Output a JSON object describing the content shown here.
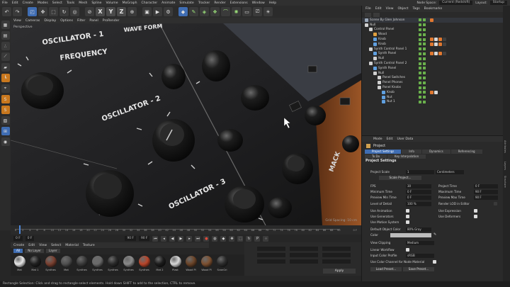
{
  "menu": {
    "items": [
      "File",
      "Edit",
      "Create",
      "Modes",
      "Select",
      "Tools",
      "Mesh",
      "Spline",
      "Volume",
      "MoGraph",
      "Character",
      "Animate",
      "Simulate",
      "Tracker",
      "Render",
      "Extensions",
      "Window",
      "Help"
    ],
    "node_space_label": "Node Space:",
    "node_space_value": "Current (Redshift)",
    "layout_label": "Layout:",
    "layout_value": "Startup"
  },
  "toolbar": {
    "axes": [
      "X",
      "Y",
      "Z"
    ]
  },
  "viewport": {
    "menu": [
      "View",
      "Cameras",
      "Display",
      "Options",
      "Filter",
      "Panel",
      "ProRender"
    ],
    "camera_label": "Perspective",
    "grid_info": "Grid Spacing: 10 cm",
    "panel_text": {
      "osc1": "OSCILLATOR - 1",
      "freq": "FREQUENCY",
      "wave": "WAVE FORM",
      "osc2": "OSCILLATOR - 2",
      "osc3": "OSCILLATOR - 3",
      "brand": "MACK"
    }
  },
  "timeline": {
    "ticks": [
      "0",
      "2",
      "4",
      "6",
      "8",
      "10",
      "12",
      "14",
      "16",
      "18",
      "20",
      "22",
      "24",
      "26",
      "28",
      "30",
      "32",
      "34",
      "36",
      "38",
      "40",
      "42",
      "44",
      "46",
      "48",
      "50",
      "52",
      "54",
      "56",
      "58",
      "60",
      "62",
      "64",
      "66",
      "68",
      "70",
      "72",
      "74",
      "76",
      "78",
      "80",
      "82",
      "84",
      "86",
      "88",
      "90"
    ],
    "end_label": "0 F"
  },
  "playback": {
    "start": "0 F",
    "current": "0 F",
    "end": "90 F",
    "end2": "90 F"
  },
  "materials": {
    "menu": [
      "Create",
      "Edit",
      "View",
      "Select",
      "Material",
      "Texture"
    ],
    "filters": [
      "All",
      "No Layer",
      "Layer"
    ],
    "items": [
      {
        "label": "Mat",
        "color": "#e8e8e8"
      },
      {
        "label": "Mat 1",
        "color": "#202020"
      },
      {
        "label": "Synthes",
        "color": "#7a4030"
      },
      {
        "label": "Mat",
        "color": "#505050"
      },
      {
        "label": "Synthes",
        "color": "#3a3a3a"
      },
      {
        "label": "Synthes",
        "color": "#6a6a6a"
      },
      {
        "label": "Synthes",
        "color": "#2a2a2a"
      },
      {
        "label": "Synthes",
        "color": "#8a8a8a"
      },
      {
        "label": "Synthes",
        "color": "#b8452a"
      },
      {
        "label": "Mat 2",
        "color": "#1c1c1c"
      },
      {
        "label": "Plast",
        "color": "#d8d8d8"
      },
      {
        "label": "Wood Pl",
        "color": "#6b4428"
      },
      {
        "label": "Wood Pl",
        "color": "#7d5030"
      },
      {
        "label": "ScanGri",
        "color": "#2c2c2c"
      }
    ]
  },
  "coords": {
    "apply_label": "Apply"
  },
  "status": {
    "text": "Rectangle Selection: Click and drag to rectangle-select elements. Hold down SHIFT to add to the selection, CTRL to remove."
  },
  "objects": {
    "menu": [
      "File",
      "Edit",
      "View",
      "Object",
      "Tags",
      "Bookmarks"
    ],
    "rows": [
      {
        "label": "Scene By Glen Johnson",
        "indent": 0,
        "color": "#9aa7b8"
      },
      {
        "label": "Null",
        "indent": 0,
        "color": "#d0d0d0"
      },
      {
        "label": "Control Panel",
        "indent": 1,
        "color": "#d0d0d0"
      },
      {
        "label": "Wood",
        "indent": 2,
        "color": "#e0a040"
      },
      {
        "label": "Knob",
        "indent": 2,
        "color": "#60a0e0"
      },
      {
        "label": "Knob",
        "indent": 2,
        "color": "#60a0e0"
      },
      {
        "label": "Synth Control Panel 1",
        "indent": 1,
        "color": "#d0d0d0"
      },
      {
        "label": "Synth Panel",
        "indent": 2,
        "color": "#60a0e0"
      },
      {
        "label": "Null",
        "indent": 2,
        "color": "#d0d0d0"
      },
      {
        "label": "Synth Control Panel 2",
        "indent": 1,
        "color": "#d0d0d0"
      },
      {
        "label": "Synth Panel",
        "indent": 2,
        "color": "#60a0e0"
      },
      {
        "label": "Null",
        "indent": 2,
        "color": "#d0d0d0"
      },
      {
        "label": "Panel Switches",
        "indent": 3,
        "color": "#d0d0d0"
      },
      {
        "label": "Panel Phones",
        "indent": 3,
        "color": "#d0d0d0"
      },
      {
        "label": "Panel Knobs",
        "indent": 3,
        "color": "#d0d0d0"
      },
      {
        "label": "Knob",
        "indent": 4,
        "color": "#60a0e0"
      },
      {
        "label": "Nut",
        "indent": 4,
        "color": "#60a0e0"
      },
      {
        "label": "Nut 1",
        "indent": 4,
        "color": "#60a0e0"
      }
    ]
  },
  "attributes": {
    "menu": [
      "Mode",
      "Edit",
      "User Data"
    ],
    "header": "Project",
    "tabs_row1": [
      "Project Settings",
      "Info",
      "Dynamics",
      "Referencing"
    ],
    "tabs_row2": [
      "To Do",
      "Key Interpolation"
    ],
    "section": "Project Settings",
    "project_scale_label": "Project Scale",
    "project_scale_value": "1",
    "project_scale_unit": "Centimeters",
    "scale_project_btn": "Scale Project...",
    "fps_label": "FPS",
    "fps_value": "30",
    "project_time_label": "Project Time",
    "project_time_value": "0 F",
    "min_time_label": "Minimum Time",
    "min_time_value": "0 F",
    "max_time_label": "Maximum Time",
    "max_time_value": "90 F",
    "prev_min_label": "Preview Min Time",
    "prev_min_value": "0 F",
    "prev_max_label": "Preview Max Time",
    "prev_max_value": "90 F",
    "lod_label": "Level of Detail",
    "lod_value": "100 %",
    "render_lod_label": "Render LOD in Editor",
    "use_animation": "Use Animation",
    "use_expression": "Use Expression",
    "use_generators": "Use Generators",
    "use_deformers": "Use Deformers",
    "use_motion": "Use Motion System",
    "default_color_label": "Default Object Color",
    "default_color_value": "80% Gray",
    "color_label": "Color",
    "view_clipping_label": "View Clipping",
    "view_clipping_value": "Medium",
    "linear_workflow": "Linear Workflow",
    "input_color_label": "Input Color Profile",
    "input_color_value": "sRGB",
    "use_color_channel": "Use Color Channel for Node Material",
    "load_preset_btn": "Load Preset...",
    "save_preset_btn": "Save Preset..."
  },
  "sidetabs": [
    "Attributes",
    "Layers",
    "Structure"
  ]
}
